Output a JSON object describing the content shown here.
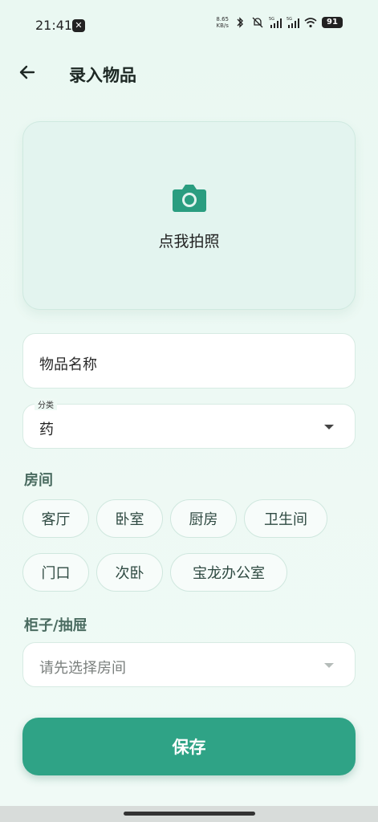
{
  "status_bar": {
    "time": "21:41",
    "net_speed_value": "8.65",
    "net_speed_unit": "KB/s",
    "signal_1_label": "5G",
    "signal_2_label": "5G",
    "battery": "91",
    "icons": [
      "app-notification-icon",
      "bluetooth-icon",
      "mute-icon",
      "signal-icon",
      "wifi-icon",
      "battery-icon"
    ]
  },
  "header": {
    "title": "录入物品",
    "back_icon": "arrow-left-icon"
  },
  "photo": {
    "label": "点我拍照",
    "icon": "camera-icon"
  },
  "form": {
    "name_placeholder": "物品名称",
    "category_label": "分类",
    "category_value": "药",
    "room_title": "房间",
    "rooms": [
      "客厅",
      "卧室",
      "厨房",
      "卫生间",
      "门口",
      "次卧",
      "宝龙办公室"
    ],
    "cabinet_title": "柜子/抽屉",
    "cabinet_placeholder": "请先选择房间"
  },
  "actions": {
    "save_label": "保存"
  },
  "colors": {
    "accent": "#2fa386",
    "background": "#eef9f4",
    "camera": "#2a9d80"
  }
}
